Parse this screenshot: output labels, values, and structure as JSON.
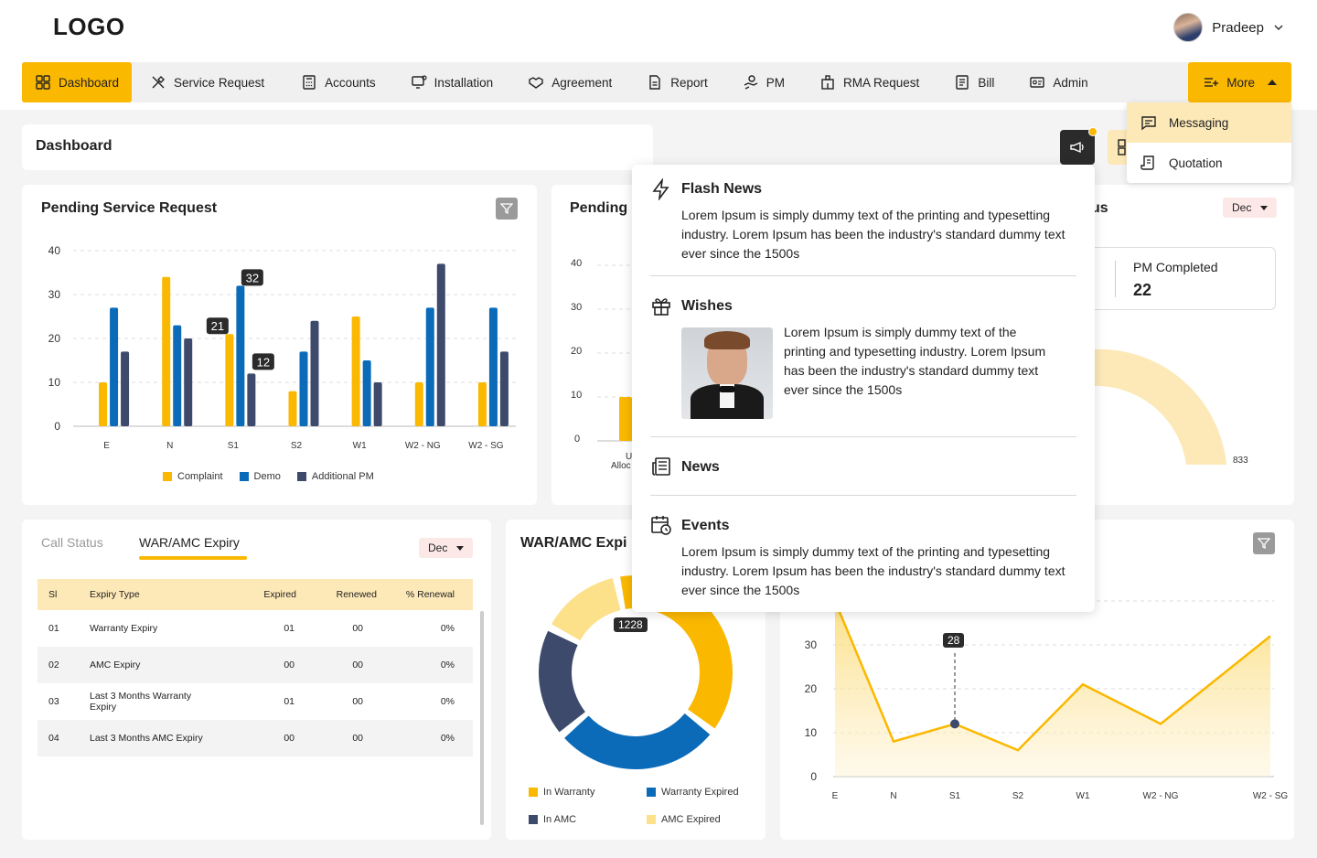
{
  "header": {
    "logo": "LOGO",
    "user_name": "Pradeep"
  },
  "nav": {
    "items": [
      {
        "label": "Dashboard",
        "icon": "dashboard-icon"
      },
      {
        "label": "Service Request",
        "icon": "tools-icon"
      },
      {
        "label": "Accounts",
        "icon": "calculator-icon"
      },
      {
        "label": "Installation",
        "icon": "monitor-icon"
      },
      {
        "label": "Agreement",
        "icon": "handshake-icon"
      },
      {
        "label": "Report",
        "icon": "document-icon"
      },
      {
        "label": "PM",
        "icon": "hand-gear-icon"
      },
      {
        "label": "RMA Request",
        "icon": "building-icon"
      },
      {
        "label": "Bill",
        "icon": "bill-icon"
      },
      {
        "label": "Admin",
        "icon": "id-card-icon"
      }
    ],
    "more_label": "More"
  },
  "more_menu": {
    "items": [
      {
        "label": "Messaging"
      },
      {
        "label": "Quotation"
      }
    ]
  },
  "page": {
    "title": "Dashboard"
  },
  "pending_sr": {
    "title": "Pending Service Request",
    "chart_data": {
      "type": "bar",
      "categories": [
        "E",
        "N",
        "S1",
        "S2",
        "W1",
        "W2 - NG",
        "W2 - SG"
      ],
      "series": [
        {
          "name": "Complaint",
          "values": [
            10,
            34,
            21,
            8,
            25,
            10,
            10
          ],
          "color": "#fbb800"
        },
        {
          "name": "Demo",
          "values": [
            27,
            23,
            32,
            17,
            15,
            27,
            27
          ],
          "color": "#0b6bb8"
        },
        {
          "name": "Additional PM",
          "values": [
            17,
            20,
            12,
            24,
            10,
            37,
            17
          ],
          "color": "#3d4a6b"
        }
      ],
      "yticks": [
        "0",
        "10",
        "20",
        "30",
        "40"
      ],
      "ylim": [
        0,
        40
      ],
      "tooltips": [
        "32",
        "21",
        "12"
      ],
      "legend": "bottom"
    }
  },
  "pending2": {
    "title_visible": "Pending",
    "yticks": [
      "0",
      "10",
      "20",
      "30",
      "40"
    ],
    "xlabel_partial_1": "U",
    "xlabel_partial_2": "Alloc"
  },
  "pm_status": {
    "title_suffix": "us",
    "month": "Dec",
    "completed_label": "PM Completed",
    "completed_value": "22",
    "gauge_value_label": "833"
  },
  "war": {
    "tabs": [
      "Call Status",
      "WAR/AMC Expiry"
    ],
    "month": "Dec",
    "columns": [
      "Sl",
      "Expiry Type",
      "Expired",
      "Renewed",
      "% Renewal"
    ],
    "rows": [
      [
        "01",
        "Warranty Expiry",
        "01",
        "00",
        "0%"
      ],
      [
        "02",
        "AMC Expiry",
        "00",
        "00",
        "0%"
      ],
      [
        "03",
        "Last 3 Months Warranty Expiry",
        "01",
        "00",
        "0%"
      ],
      [
        "04",
        "Last 3 Months AMC Expiry",
        "00",
        "00",
        "0%"
      ]
    ]
  },
  "war_chart": {
    "title_visible": "WAR/AMC Expi",
    "tooltip": "1228",
    "chart_data": {
      "type": "pie",
      "labels": [
        "In Warranty",
        "Warranty Expired",
        "In AMC",
        "AMC Expired"
      ],
      "values": [
        1228,
        900,
        600,
        450
      ],
      "colors": [
        "#fbb800",
        "#0b6bb8",
        "#3d4a6b",
        "#fde08a"
      ],
      "legend": "bottom"
    }
  },
  "line_chart": {
    "tooltip": "28",
    "chart_data": {
      "type": "area",
      "categories": [
        "E",
        "N",
        "S1",
        "S2",
        "W1",
        "W2 - NG",
        "W2 - SG"
      ],
      "values": [
        40,
        8,
        12,
        6,
        21,
        12,
        32
      ],
      "yticks": [
        "0",
        "10",
        "20",
        "30"
      ],
      "ylim": [
        0,
        40
      ],
      "color": "#fbb800"
    }
  },
  "popup": {
    "flash_title": "Flash News",
    "flash_text": "Lorem Ipsum is simply dummy text of the printing and typesetting industry. Lorem Ipsum has been the industry's standard dummy text ever since the 1500s",
    "wishes_title": "Wishes",
    "wishes_text": "Lorem Ipsum is simply dummy text of the printing and typesetting industry. Lorem Ipsum has been the industry's standard dummy text ever since the 1500s",
    "news_title": "News",
    "events_title": "Events",
    "events_text": "Lorem Ipsum is simply dummy text of the printing and typesetting industry. Lorem Ipsum has been the industry's standard dummy text ever since the 1500s"
  }
}
